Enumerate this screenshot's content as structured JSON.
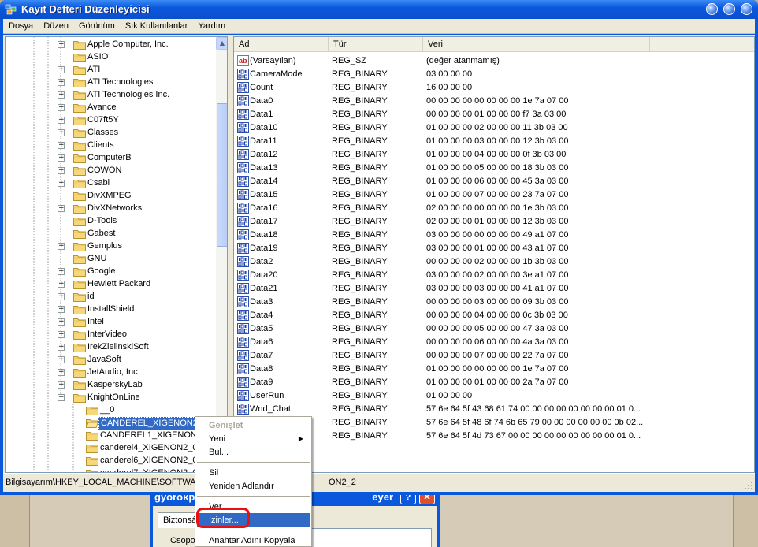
{
  "window": {
    "title": "Kayıt Defteri Düzenleyicisi"
  },
  "menu": [
    "Dosya",
    "Düzen",
    "Görünüm",
    "Sık Kullanılanlar",
    "Yardım"
  ],
  "tree": {
    "items": [
      {
        "label": "Apple Computer, Inc.",
        "expandable": true
      },
      {
        "label": "ASIO",
        "expandable": false
      },
      {
        "label": "ATI",
        "expandable": true
      },
      {
        "label": "ATI Technologies",
        "expandable": true
      },
      {
        "label": "ATI Technologies Inc.",
        "expandable": true
      },
      {
        "label": "Avance",
        "expandable": true
      },
      {
        "label": "C07ft5Y",
        "expandable": true
      },
      {
        "label": "Classes",
        "expandable": true
      },
      {
        "label": "Clients",
        "expandable": true
      },
      {
        "label": "ComputerB",
        "expandable": true
      },
      {
        "label": "COWON",
        "expandable": true
      },
      {
        "label": "Csabi",
        "expandable": true
      },
      {
        "label": "DivXMPEG",
        "expandable": false
      },
      {
        "label": "DivXNetworks",
        "expandable": true
      },
      {
        "label": "D-Tools",
        "expandable": false
      },
      {
        "label": "Gabest",
        "expandable": false
      },
      {
        "label": "Gemplus",
        "expandable": true
      },
      {
        "label": "GNU",
        "expandable": false
      },
      {
        "label": "Google",
        "expandable": true
      },
      {
        "label": "Hewlett Packard",
        "expandable": true
      },
      {
        "label": "id",
        "expandable": true
      },
      {
        "label": "InstallShield",
        "expandable": true
      },
      {
        "label": "Intel",
        "expandable": true
      },
      {
        "label": "InterVideo",
        "expandable": true
      },
      {
        "label": "IrekZielinskiSoft",
        "expandable": true
      },
      {
        "label": "JavaSoft",
        "expandable": true
      },
      {
        "label": "JetAudio, Inc.",
        "expandable": true
      },
      {
        "label": "KasperskyLab",
        "expandable": true
      },
      {
        "label": "KnightOnLine",
        "expandable": true,
        "expanded": true
      }
    ],
    "children": [
      {
        "label": "__0"
      },
      {
        "label": "CANDEREL_XIGENON2_2",
        "selected": true
      },
      {
        "label": "CANDEREL1_XIGENON2_"
      },
      {
        "label": "canderel4_XIGENON2_0"
      },
      {
        "label": "canderel6_XIGENON2_0"
      },
      {
        "label": "canderel7_XIGENON2_0"
      }
    ]
  },
  "list": {
    "columns": [
      "Ad",
      "Tür",
      "Veri"
    ],
    "rows": [
      {
        "name": "(Varsayılan)",
        "type": "REG_SZ",
        "data": "(değer atanmamış)",
        "icon": "string"
      },
      {
        "name": "CameraMode",
        "type": "REG_BINARY",
        "data": "03 00 00 00",
        "icon": "binary"
      },
      {
        "name": "Count",
        "type": "REG_BINARY",
        "data": "16 00 00 00",
        "icon": "binary"
      },
      {
        "name": "Data0",
        "type": "REG_BINARY",
        "data": "00 00 00 00 00 00 00 00 1e 7a 07 00",
        "icon": "binary"
      },
      {
        "name": "Data1",
        "type": "REG_BINARY",
        "data": "00 00 00 00 01 00 00 00 f7 3a 03 00",
        "icon": "binary"
      },
      {
        "name": "Data10",
        "type": "REG_BINARY",
        "data": "01 00 00 00 02 00 00 00 11 3b 03 00",
        "icon": "binary"
      },
      {
        "name": "Data11",
        "type": "REG_BINARY",
        "data": "01 00 00 00 03 00 00 00 12 3b 03 00",
        "icon": "binary"
      },
      {
        "name": "Data12",
        "type": "REG_BINARY",
        "data": "01 00 00 00 04 00 00 00 0f 3b 03 00",
        "icon": "binary"
      },
      {
        "name": "Data13",
        "type": "REG_BINARY",
        "data": "01 00 00 00 05 00 00 00 18 3b 03 00",
        "icon": "binary"
      },
      {
        "name": "Data14",
        "type": "REG_BINARY",
        "data": "01 00 00 00 06 00 00 00 45 3a 03 00",
        "icon": "binary"
      },
      {
        "name": "Data15",
        "type": "REG_BINARY",
        "data": "01 00 00 00 07 00 00 00 23 7a 07 00",
        "icon": "binary"
      },
      {
        "name": "Data16",
        "type": "REG_BINARY",
        "data": "02 00 00 00 00 00 00 00 1e 3b 03 00",
        "icon": "binary"
      },
      {
        "name": "Data17",
        "type": "REG_BINARY",
        "data": "02 00 00 00 01 00 00 00 12 3b 03 00",
        "icon": "binary"
      },
      {
        "name": "Data18",
        "type": "REG_BINARY",
        "data": "03 00 00 00 00 00 00 00 49 a1 07 00",
        "icon": "binary"
      },
      {
        "name": "Data19",
        "type": "REG_BINARY",
        "data": "03 00 00 00 01 00 00 00 43 a1 07 00",
        "icon": "binary"
      },
      {
        "name": "Data2",
        "type": "REG_BINARY",
        "data": "00 00 00 00 02 00 00 00 1b 3b 03 00",
        "icon": "binary"
      },
      {
        "name": "Data20",
        "type": "REG_BINARY",
        "data": "03 00 00 00 02 00 00 00 3e a1 07 00",
        "icon": "binary"
      },
      {
        "name": "Data21",
        "type": "REG_BINARY",
        "data": "03 00 00 00 03 00 00 00 41 a1 07 00",
        "icon": "binary"
      },
      {
        "name": "Data3",
        "type": "REG_BINARY",
        "data": "00 00 00 00 03 00 00 00 09 3b 03 00",
        "icon": "binary"
      },
      {
        "name": "Data4",
        "type": "REG_BINARY",
        "data": "00 00 00 00 04 00 00 00 0c 3b 03 00",
        "icon": "binary"
      },
      {
        "name": "Data5",
        "type": "REG_BINARY",
        "data": "00 00 00 00 05 00 00 00 47 3a 03 00",
        "icon": "binary"
      },
      {
        "name": "Data6",
        "type": "REG_BINARY",
        "data": "00 00 00 00 06 00 00 00 4a 3a 03 00",
        "icon": "binary"
      },
      {
        "name": "Data7",
        "type": "REG_BINARY",
        "data": "00 00 00 00 07 00 00 00 22 7a 07 00",
        "icon": "binary"
      },
      {
        "name": "Data8",
        "type": "REG_BINARY",
        "data": "01 00 00 00 00 00 00 00 1e 7a 07 00",
        "icon": "binary"
      },
      {
        "name": "Data9",
        "type": "REG_BINARY",
        "data": "01 00 00 00 01 00 00 00 2a 7a 07 00",
        "icon": "binary"
      },
      {
        "name": "UserRun",
        "type": "REG_BINARY",
        "data": "01 00 00 00",
        "icon": "binary"
      },
      {
        "name": "Wnd_Chat",
        "type": "REG_BINARY",
        "data": "57 6e 64 5f 43 68 61 74 00 00 00 00 00 00 00 00 01 0...",
        "icon": "binary"
      },
      {
        "name": "",
        "type": "REG_BINARY",
        "data": "57 6e 64 5f 48 6f 74 6b 65 79 00 00 00 00 00 00 0b 02...",
        "icon": "binary"
      },
      {
        "name": "",
        "type": "REG_BINARY",
        "data": "57 6e 64 5f 4d 73 67 00 00 00 00 00 00 00 00 00 01 0...",
        "icon": "binary"
      }
    ]
  },
  "status": {
    "left": "Bilgisayarım\\HKEY_LOCAL_MACHINE\\SOFTWARE\\",
    "right": "ON2_2"
  },
  "context_menu": {
    "items": [
      {
        "label": "Genişlet",
        "disabled": true
      },
      {
        "label": "Yeni",
        "submenu": true
      },
      {
        "label": "Bul..."
      },
      {
        "separator": true
      },
      {
        "label": "Sil"
      },
      {
        "label": "Yeniden Adlandır"
      },
      {
        "separator": true
      },
      {
        "label": "Ver"
      },
      {
        "label": "İzinler...",
        "highlighted": true
      },
      {
        "separator": true
      },
      {
        "label": "Anahtar Adını Kopyala"
      }
    ]
  },
  "background_window": {
    "title_left": "gyorokp",
    "title_right": "eyer",
    "tab": "Biztonsá",
    "label": "Csopo"
  },
  "colors": {
    "titlebar": "#0a58dc",
    "selection": "#316ac5",
    "annotation": "#e81010"
  }
}
